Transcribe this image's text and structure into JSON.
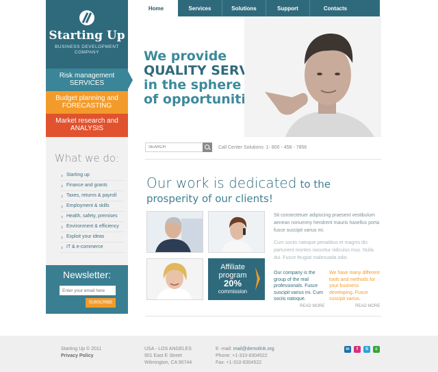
{
  "brand": {
    "name": "Starting Up",
    "subtitle_line1": "BUSINESS DEVELOPMENT",
    "subtitle_line2": "COMPANY"
  },
  "menu": [
    {
      "line1": "Risk management",
      "line2": "SERVICES"
    },
    {
      "line1": "Budget planning and",
      "line2": "FORECASTING"
    },
    {
      "line1": "Market research and",
      "line2": "ANALYSIS"
    }
  ],
  "what_we_do": {
    "title": "What we do:",
    "items": [
      "Starting up",
      "Finance and grants",
      "Taxes, returns & payroll",
      "Employment & skills",
      "Health, safety, premises",
      "Environment & efficiency",
      "Exploit your ideas",
      "IT & e-commerce"
    ]
  },
  "newsletter": {
    "title": "Newsletter:",
    "placeholder": "Enter your email here",
    "button": "SUBSCRIBE"
  },
  "nav": [
    "Home",
    "Services",
    "Solutions",
    "Support",
    "Contacts"
  ],
  "hero": {
    "line1": "We provide",
    "line2": "QUALITY SERVICES",
    "line3": "in the sphere",
    "line4": "of opportunities"
  },
  "search": {
    "placeholder": "SEARCH",
    "call_center": "Call Center Solutions: 1- 800 - 458 - 7856"
  },
  "dedicated": {
    "big": "Our work is dedicated",
    "small": "to the",
    "line2": "prosperity of our clients!"
  },
  "affiliate": {
    "line1": "Affiliate",
    "line2": "program",
    "pct": "20%",
    "line3": "commission"
  },
  "content": {
    "text1": "Sit consectetuer adipiscing praesent vestibulum aenean nonummy hendrerit mauris hasellus porta fusce suscipit varius mi.",
    "text2": "Cum sociis natoque penatibus et magnis dis parturient montes nascetur ridiculus mus. Nulla dui. Fusce feugiat malesuada odio.",
    "blue": "Our company is the group of the real professionals. Fusce suscipit varius mi. Cum sociis natoque.",
    "orange": "We have many different tools and methods for your business developing. Fusce suscipit varius.",
    "read_more": "READ MORE"
  },
  "footer": {
    "copyright": "Starting Up © 2011",
    "privacy": "Privacy Policy",
    "addr1": "USA - LOS ANGELES",
    "addr2": "901 East E Street",
    "addr3": "Wilmington, CA 90744",
    "email_label": "E -mail:",
    "email": "mail@demolink.org",
    "phone": "Phone: +1-310-8304522",
    "fax": "Fax: +1-310-8304522"
  },
  "social": [
    {
      "icon": "linkedin-icon",
      "glyph": "in",
      "color": "#1f6fa8"
    },
    {
      "icon": "flickr-icon",
      "glyph": "f",
      "color": "#d6317a"
    },
    {
      "icon": "skype-icon",
      "glyph": "S",
      "color": "#2aa3d8"
    },
    {
      "icon": "chat-icon",
      "glyph": "c",
      "color": "#3aa33a"
    }
  ],
  "colors": {
    "teal_dark": "#2f6a7c",
    "teal": "#3a8597",
    "orange": "#f39b2a",
    "red": "#e1522e"
  }
}
